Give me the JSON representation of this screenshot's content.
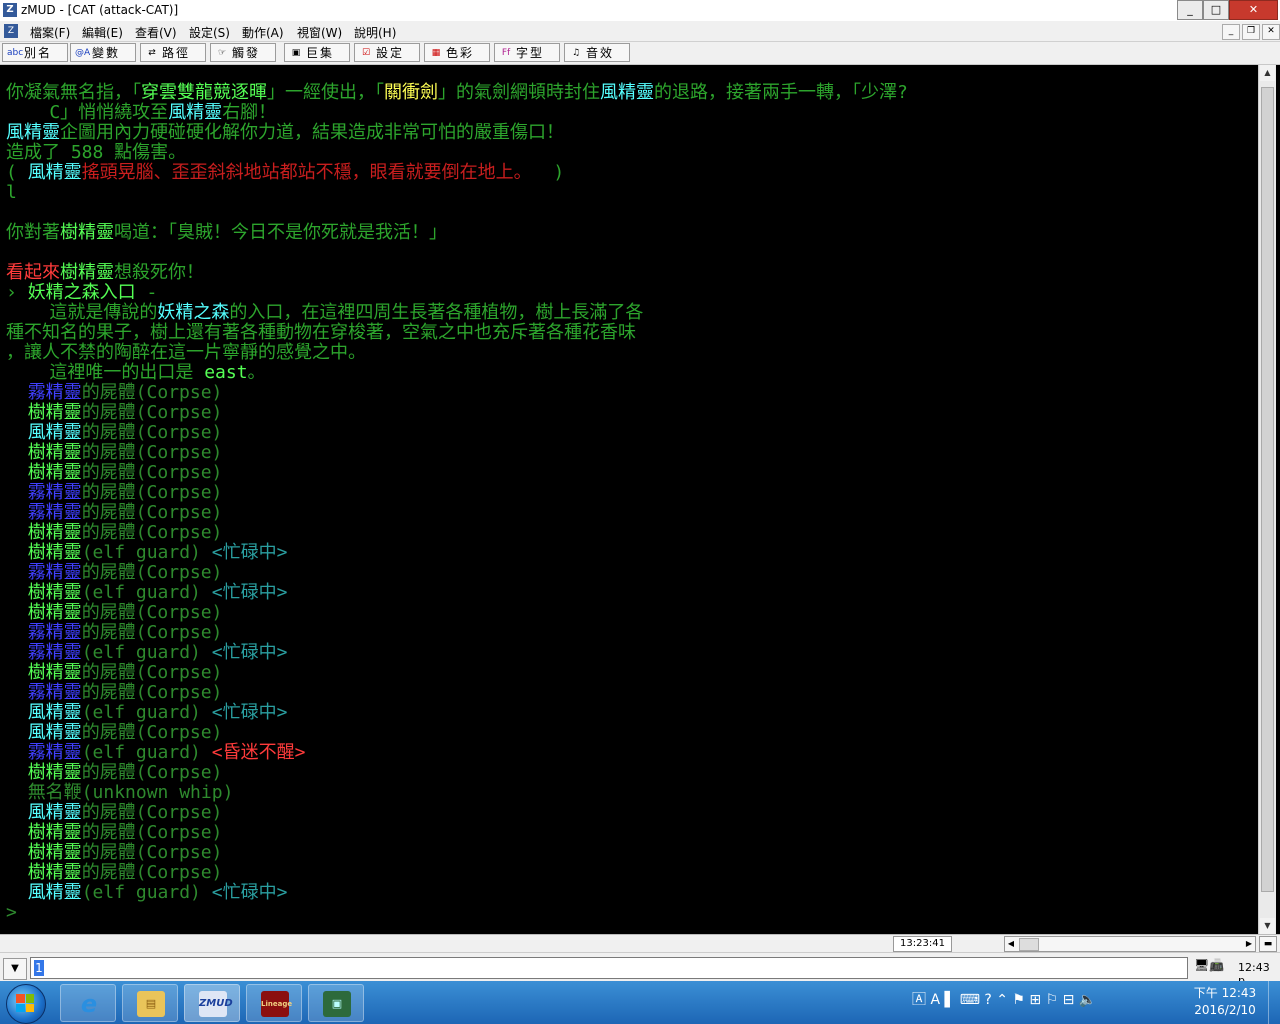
{
  "window": {
    "title": "zMUD - [CAT (attack-CAT)]",
    "app_icon": "Z",
    "min": "_",
    "max": "□",
    "close": "✕"
  },
  "menu": {
    "items": [
      "檔案(F)",
      "編輯(E)",
      "查看(V)",
      "設定(S)",
      "動作(A)",
      "視窗(W)",
      "說明(H)"
    ],
    "mdi_min": "_",
    "mdi_restore": "❐",
    "mdi_close": "✕"
  },
  "buttons": [
    {
      "icon": "abc",
      "label": "別名"
    },
    {
      "icon": "@A",
      "label": "變數"
    },
    {
      "icon": "⇄",
      "label": "路徑"
    },
    {
      "icon": "☞",
      "label": "觸發"
    },
    {
      "icon": "▣",
      "label": "巨集"
    },
    {
      "icon": "☑",
      "label": "設定"
    },
    {
      "icon": "▦",
      "label": "色彩"
    },
    {
      "icon": "Ff",
      "label": "字型"
    },
    {
      "icon": "♫",
      "label": "音效"
    }
  ],
  "terminal": {
    "l1a": "你凝氣無名指，「",
    "l1b": "穿雲雙龍競逐暉",
    "l1c": "」一經使出，「",
    "l1d": "關衝劍",
    "l1e": "」的氣劍網頓時封住",
    "l1f": "風精靈",
    "l1g": "的退路，接著兩手一轉，「少澤?",
    "l2a": "    C」悄悄繞攻至",
    "l2b": "風精靈",
    "l2c": "右腳！",
    "l3a": "風精靈",
    "l3b": "企圖用內力硬碰硬化解你力道，結果造成非常可怕的嚴重傷口！",
    "l4": "造成了 588 點傷害。",
    "l5a": "( ",
    "l5b": "風精靈",
    "l5c": "搖頭晃腦、歪歪斜斜地站都站不穩，眼看就要倒在地上。",
    "l5d": "  )",
    "l6": "l",
    "l8a": "你對著",
    "l8b": "樹精靈",
    "l8c": "喝道：「臭賊！今日不是你死就是我活！」",
    "l10a": "看起來",
    "l10b": "樹精靈",
    "l10c": "想殺死你！",
    "l11a": "› ",
    "l11b": "妖精之森入口",
    "l11c": " -",
    "l12a": "    這就是傳說的",
    "l12b": "妖精之森",
    "l12c": "的入口，在這裡四周生長著各種植物，樹上長滿了各",
    "l13": "種不知名的果子，樹上還有著各種動物在穿梭著，空氣之中也充斥著各種花香味",
    "l14": "，讓人不禁的陶醉在這一片寧靜的感覺之中。",
    "l15a": "    這裡唯一的出口是 ",
    "l15b": "east",
    "l15c": "。",
    "corpse_suffix": "的屍體(Corpse)",
    "guard_suffix": "(elf guard) ",
    "busy": "<忙碌中>",
    "coma": "<昏迷不醒>",
    "whip": "無名鞭(unknown whip)",
    "fog": "霧精靈",
    "tree": "樹精靈",
    "wind": "風精靈",
    "prompt": ">"
  },
  "status": {
    "time": "13:23:41"
  },
  "command": {
    "value": "",
    "cursor": "1",
    "dropdown": "▼",
    "clock": "12:43 p"
  },
  "taskbar": {
    "apps": [
      {
        "name": "ie",
        "glyph": "e"
      },
      {
        "name": "explorer",
        "glyph": "▤"
      },
      {
        "name": "zmud",
        "glyph": "ZMUD"
      },
      {
        "name": "lineage",
        "glyph": "Lineage"
      },
      {
        "name": "remote",
        "glyph": "▣"
      }
    ],
    "tray": "🄰 A ▌ ⌨ ? ⌃ ⚑ ⊞ ⚐ ⊟ 🔈",
    "time": "下午 12:43",
    "date": "2016/2/10"
  }
}
